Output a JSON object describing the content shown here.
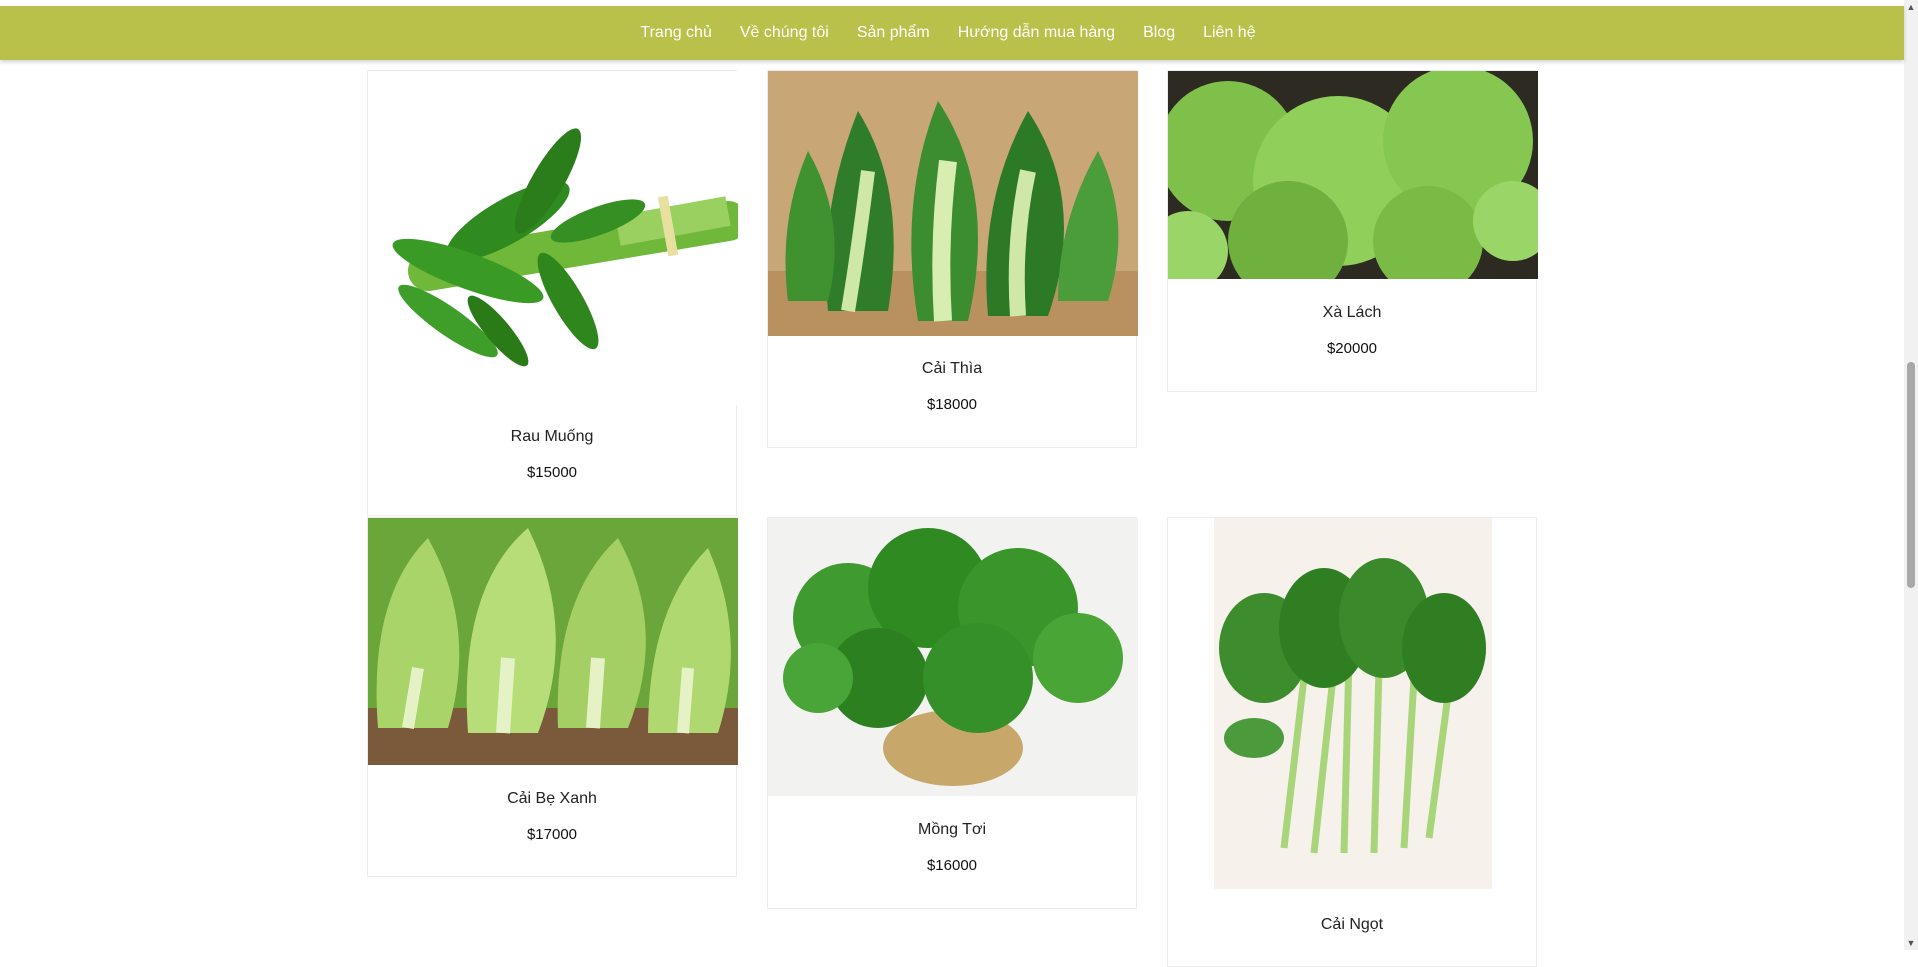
{
  "nav": {
    "items": [
      {
        "label": "Trang chủ"
      },
      {
        "label": "Về chúng tôi"
      },
      {
        "label": "Sản phẩm"
      },
      {
        "label": "Hướng dẫn mua hàng"
      },
      {
        "label": "Blog"
      },
      {
        "label": "Liên hệ"
      }
    ]
  },
  "colors": {
    "nav_bg": "#b9c14a",
    "nav_text": "#ffffff",
    "leaf_dark": "#2f7a1e",
    "leaf_light": "#8fcf5a"
  },
  "products": [
    {
      "name": "Rau Muống",
      "price": "$15000",
      "image": "water-spinach-image"
    },
    {
      "name": "Cải Thìa",
      "price": "$18000",
      "image": "bok-choy-image"
    },
    {
      "name": "Xà Lách",
      "price": "$20000",
      "image": "lettuce-image"
    },
    {
      "name": "Cải Bẹ Xanh",
      "price": "$17000",
      "image": "mustard-greens-image"
    },
    {
      "name": "Mồng Tơi",
      "price": "$16000",
      "image": "malabar-spinach-image"
    },
    {
      "name": "Cải Ngọt",
      "price": "",
      "image": "choy-sum-image"
    }
  ]
}
